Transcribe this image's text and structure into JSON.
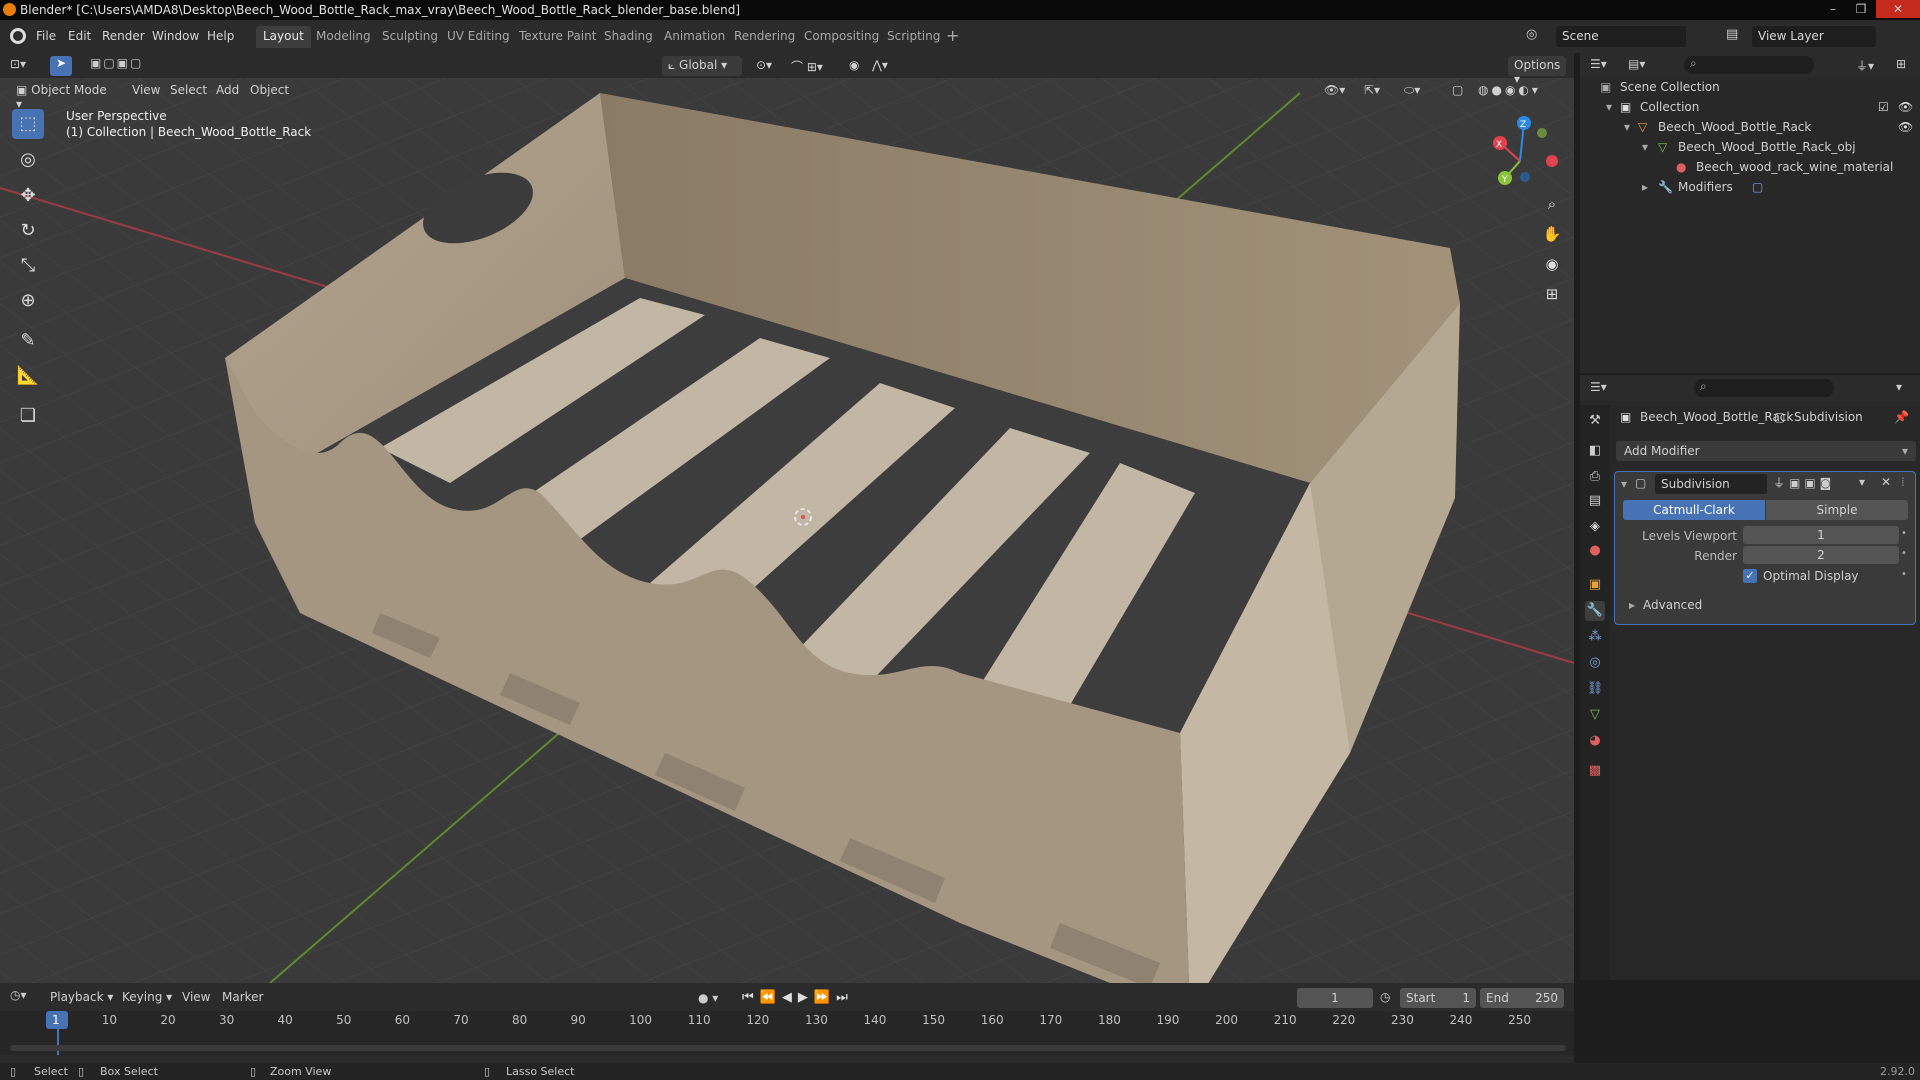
{
  "window": {
    "title": "Blender* [C:\\Users\\AMDA8\\Desktop\\Beech_Wood_Bottle_Rack_max_vray\\Beech_Wood_Bottle_Rack_blender_base.blend]",
    "controls": [
      "–",
      "❐",
      "✕"
    ]
  },
  "menubar": {
    "menus": [
      "File",
      "Edit",
      "Render",
      "Window",
      "Help"
    ],
    "workspaces": [
      "Layout",
      "Modeling",
      "Sculpting",
      "UV Editing",
      "Texture Paint",
      "Shading",
      "Animation",
      "Rendering",
      "Compositing",
      "Scripting"
    ],
    "add_workspace": "+",
    "scene": "Scene",
    "view_layer": "View Layer"
  },
  "toolheader": {
    "orientation": "Global",
    "options": "Options"
  },
  "viewheader": {
    "mode": "Object Mode",
    "menus": [
      "View",
      "Select",
      "Add",
      "Object"
    ]
  },
  "viewport": {
    "perspective": "User Perspective",
    "collection_info": "(1) Collection | Beech_Wood_Bottle_Rack",
    "gizmo": {
      "x": "X",
      "y": "Y",
      "z": "Z"
    }
  },
  "outliner": {
    "scene_collection": "Scene Collection",
    "collection": "Collection",
    "object": "Beech_Wood_Bottle_Rack",
    "mesh": "Beech_Wood_Bottle_Rack_obj",
    "material": "Beech_wood_rack_wine_material",
    "modifiers": "Modifiers"
  },
  "properties": {
    "object_name": "Beech_Wood_Bottle_Rack",
    "modifier_tag": "Subdivision",
    "add_modifier": "Add Modifier",
    "modifier": {
      "name": "Subdivision",
      "catmull": "Catmull-Clark",
      "simple": "Simple",
      "levels_viewport_label": "Levels Viewport",
      "levels_viewport": "1",
      "render_label": "Render",
      "render": "2",
      "optimal_display": "Optimal Display",
      "advanced": "Advanced"
    }
  },
  "timeline": {
    "menus": [
      "Playback",
      "Keying",
      "View",
      "Marker"
    ],
    "current_frame": "1",
    "start_label": "Start",
    "start": "1",
    "end_label": "End",
    "end": "250",
    "ticks": [
      "1",
      "10",
      "20",
      "30",
      "40",
      "50",
      "60",
      "70",
      "80",
      "90",
      "100",
      "110",
      "120",
      "130",
      "140",
      "150",
      "160",
      "170",
      "180",
      "190",
      "200",
      "210",
      "220",
      "230",
      "240",
      "250"
    ]
  },
  "statusbar": {
    "select": "Select",
    "box_select": "Box Select",
    "zoom_view": "Zoom View",
    "lasso_select": "Lasso Select",
    "version": "2.92.0"
  },
  "colors": {
    "accent": "#4772b3",
    "wood": "#a89a86",
    "x_axis": "#e0434f",
    "y_axis": "#8ac43a",
    "z_axis": "#2e89e6"
  }
}
